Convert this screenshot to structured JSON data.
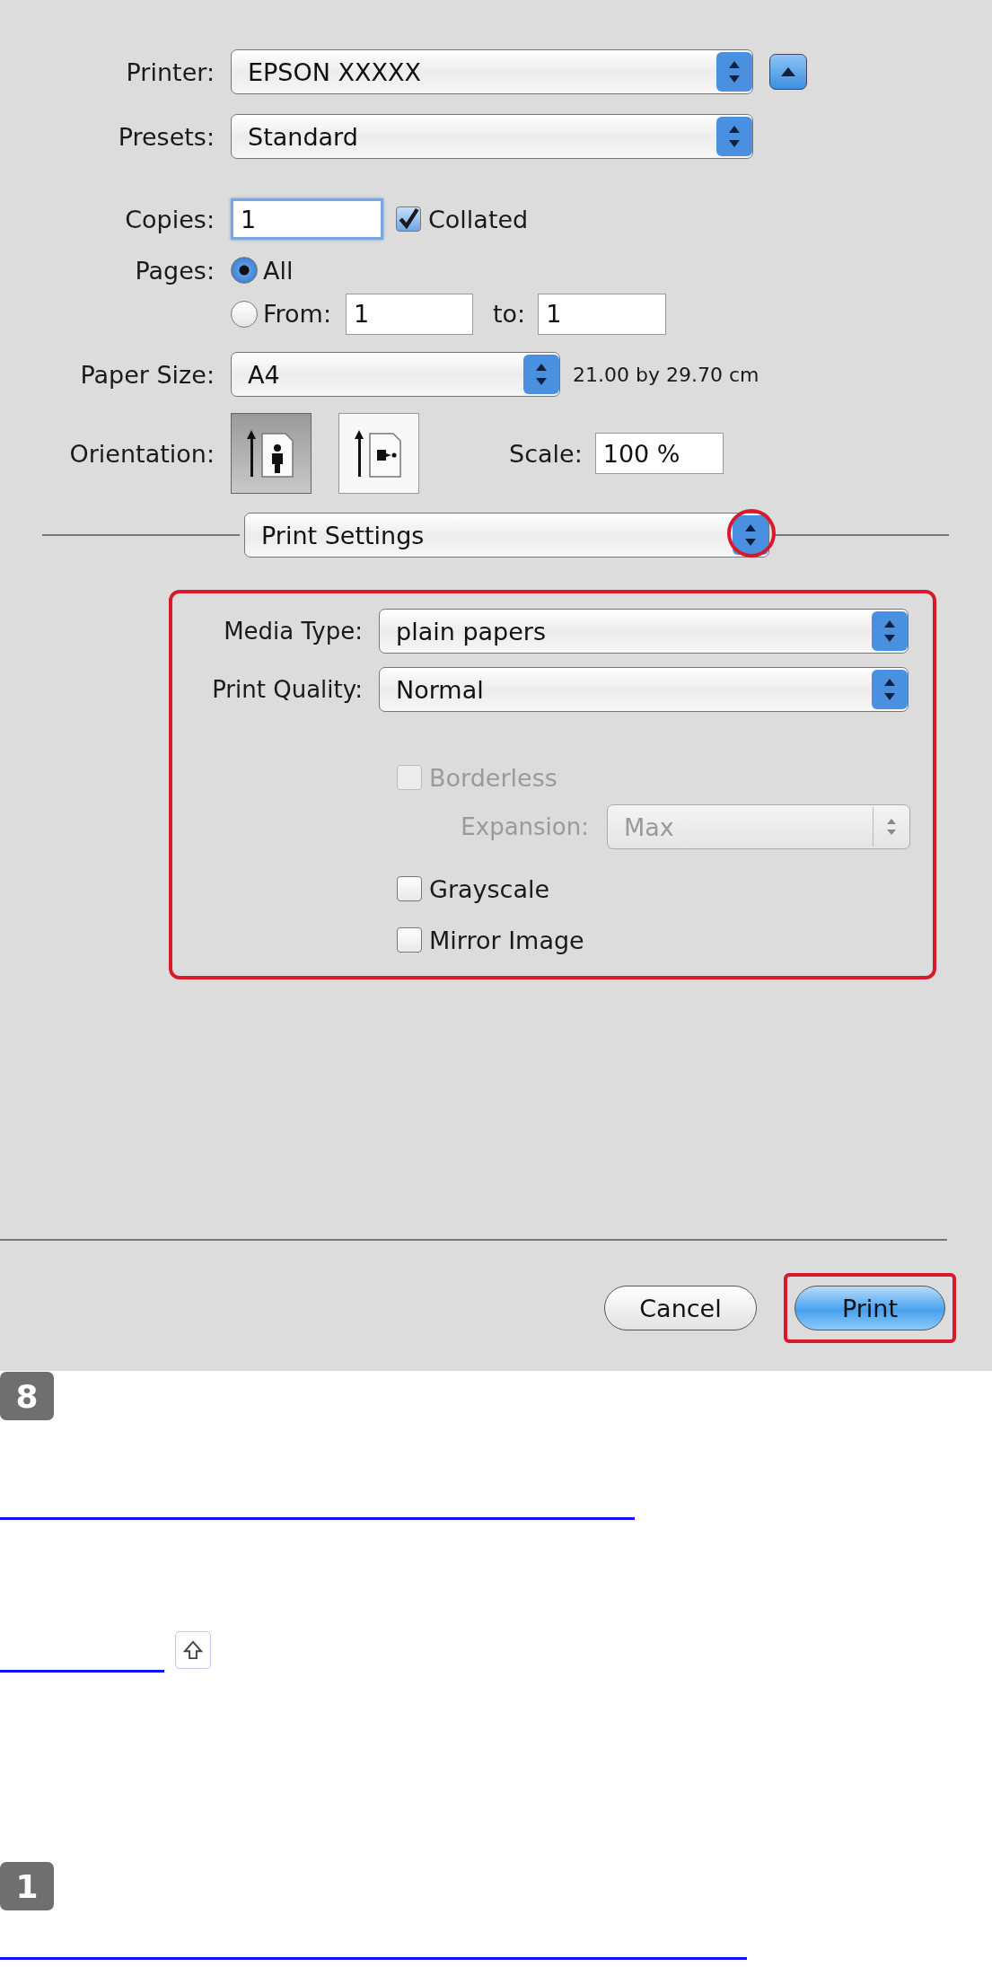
{
  "dialog": {
    "printer": {
      "label": "Printer:",
      "value": "EPSON XXXXX"
    },
    "presets": {
      "label": "Presets:",
      "value": "Standard"
    },
    "copies": {
      "label": "Copies:",
      "value": "1"
    },
    "collated": {
      "label": "Collated",
      "checked": true
    },
    "pages": {
      "label": "Pages:",
      "options": [
        {
          "label": "All",
          "selected": true
        },
        {
          "label": "From:",
          "selected": false
        }
      ],
      "from": "1",
      "to_label": "to:",
      "to": "1"
    },
    "paper_size": {
      "label": "Paper Size:",
      "value": "A4",
      "dimensions": "21.00 by 29.70 cm"
    },
    "orientation": {
      "label": "Orientation:",
      "options": [
        {
          "kind": "portrait",
          "selected": true
        },
        {
          "kind": "landscape",
          "selected": false
        }
      ]
    },
    "scale": {
      "label": "Scale:",
      "value": "100 %"
    },
    "section": {
      "value": "Print Settings",
      "highlighted": true
    },
    "print_settings": {
      "highlighted": true,
      "media_type": {
        "label": "Media Type:",
        "value": "plain papers"
      },
      "print_quality": {
        "label": "Print Quality:",
        "value": "Normal"
      },
      "borderless": {
        "label": "Borderless",
        "checked": false,
        "disabled": true
      },
      "expansion": {
        "label": "Expansion:",
        "value": "Max",
        "disabled": true
      },
      "options": [
        {
          "label": "Grayscale",
          "checked": false
        },
        {
          "label": "Mirror Image",
          "checked": false
        }
      ]
    },
    "buttons": [
      {
        "label": "Cancel",
        "default": false,
        "highlighted": false
      },
      {
        "label": "Print",
        "default": true,
        "highlighted": true
      }
    ]
  },
  "steps": [
    {
      "number": "8"
    },
    {
      "number": "1"
    }
  ]
}
